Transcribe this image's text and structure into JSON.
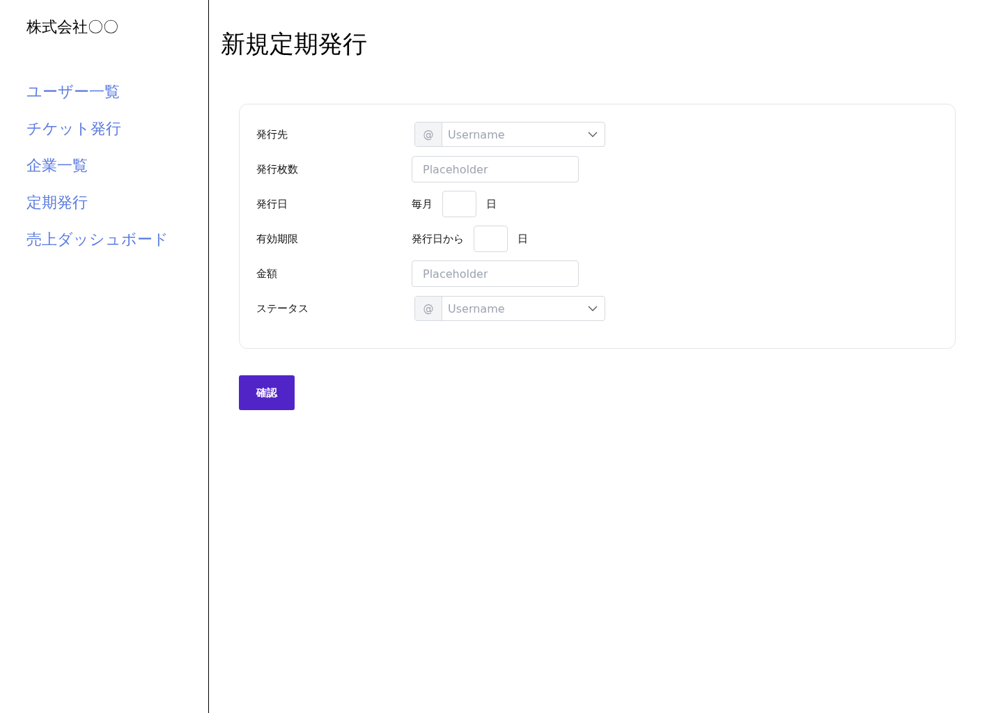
{
  "sidebar": {
    "company": "株式会社〇〇",
    "items": [
      {
        "label": "ユーザー一覧"
      },
      {
        "label": "チケット発行"
      },
      {
        "label": "企業一覧"
      },
      {
        "label": "定期発行"
      },
      {
        "label": "売上ダッシュボード"
      }
    ]
  },
  "page_title": "新規定期発行",
  "form": {
    "rows": [
      {
        "kind": "select",
        "label": "発行先",
        "prefix": "@",
        "placeholder": "Username"
      },
      {
        "kind": "input",
        "label": "発行枚数",
        "placeholder": "Placeholder"
      },
      {
        "kind": "day",
        "label": "発行日",
        "before": "毎月",
        "after": "日"
      },
      {
        "kind": "day",
        "label": "有効期限",
        "before": "発行日から",
        "after": "日"
      },
      {
        "kind": "input",
        "label": "金額",
        "placeholder": "Placeholder"
      },
      {
        "kind": "select",
        "label": "ステータス",
        "prefix": "@",
        "placeholder": "Username"
      }
    ]
  },
  "submit": "確認"
}
